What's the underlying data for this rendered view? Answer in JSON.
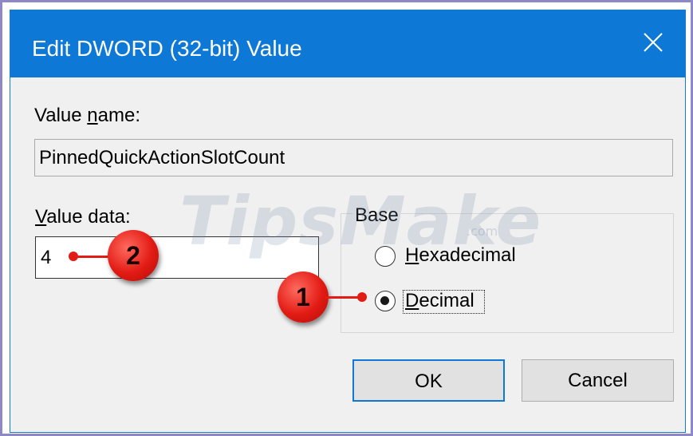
{
  "dialog": {
    "title": "Edit DWORD (32-bit) Value",
    "close_icon": "close-icon",
    "accent_color": "#0d78d6"
  },
  "value_name": {
    "label_prefix": "Value ",
    "label_access_key": "n",
    "label_suffix": "ame:",
    "value": "PinnedQuickActionSlotCount"
  },
  "value_data": {
    "label_access_key": "V",
    "label_suffix": "alue data:",
    "value": "4"
  },
  "base": {
    "label": "Base",
    "options": [
      {
        "access_key": "H",
        "rest": "exadecimal",
        "selected": false
      },
      {
        "access_key": "D",
        "rest": "ecimal",
        "selected": true
      }
    ]
  },
  "buttons": {
    "ok_label": "OK",
    "cancel_label": "Cancel"
  },
  "watermark": {
    "text": "TipsMake",
    "suffix": ".com"
  },
  "annotations": [
    {
      "number": "1"
    },
    {
      "number": "2"
    }
  ]
}
